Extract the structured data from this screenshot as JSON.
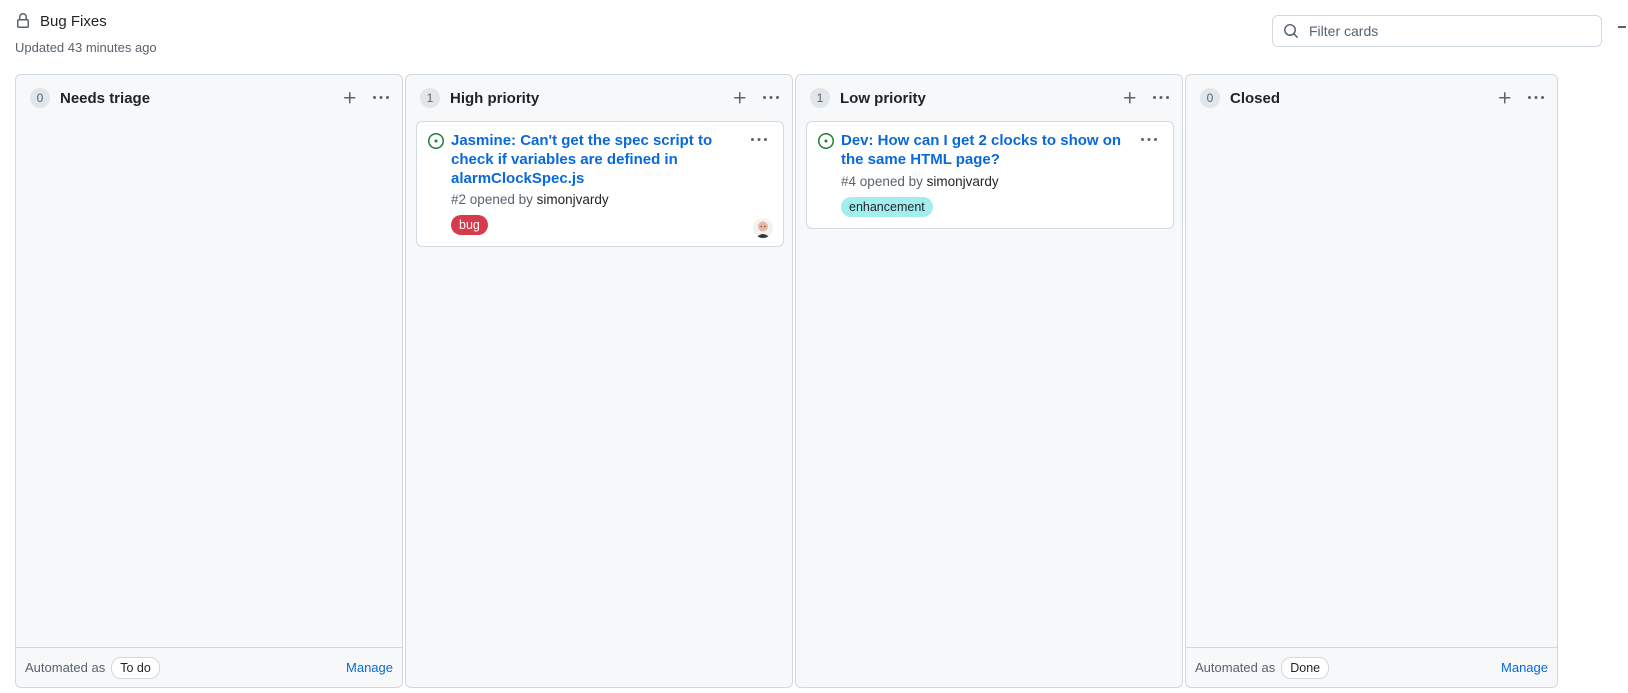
{
  "board": {
    "title": "Bug Fixes",
    "updated": "Updated 43 minutes ago"
  },
  "filter": {
    "placeholder": "Filter cards",
    "value": ""
  },
  "columns": [
    {
      "count": "0",
      "name": "Needs triage",
      "footer": {
        "automated_text": "Automated as",
        "automation": "To do",
        "manage": "Manage"
      }
    },
    {
      "count": "1",
      "name": "High priority",
      "cards": [
        {
          "title": "Jasmine: Can't get the spec script to check if variables are defined in alarmClockSpec.js",
          "number": "#2",
          "opened_by_text": "opened by",
          "author": "simonjvardy",
          "label": {
            "text": "bug",
            "bg": "#d73a4a",
            "fg": "#ffffff"
          },
          "status_icon": "issue-opened-icon",
          "has_avatar": true
        }
      ]
    },
    {
      "count": "1",
      "name": "Low priority",
      "cards": [
        {
          "title": "Dev: How can I get 2 clocks to show on the same HTML page?",
          "number": "#4",
          "opened_by_text": "opened by",
          "author": "simonjvardy",
          "label": {
            "text": "enhancement",
            "bg": "#a2eeef",
            "fg": "#1f2328"
          },
          "status_icon": "issue-opened-icon",
          "has_avatar": false
        }
      ]
    },
    {
      "count": "0",
      "name": "Closed",
      "footer": {
        "automated_text": "Automated as",
        "automation": "Done",
        "manage": "Manage"
      }
    }
  ],
  "colors": {
    "link": "#0969da",
    "open_issue": "#1a7f37",
    "column_bg": "#f6f8fa",
    "border": "#d1d9e0"
  },
  "icons": {
    "lock": "lock-icon",
    "search": "search-icon",
    "plus": "plus-icon",
    "more": "kebab-horizontal-icon",
    "issue": "issue-opened-icon"
  }
}
